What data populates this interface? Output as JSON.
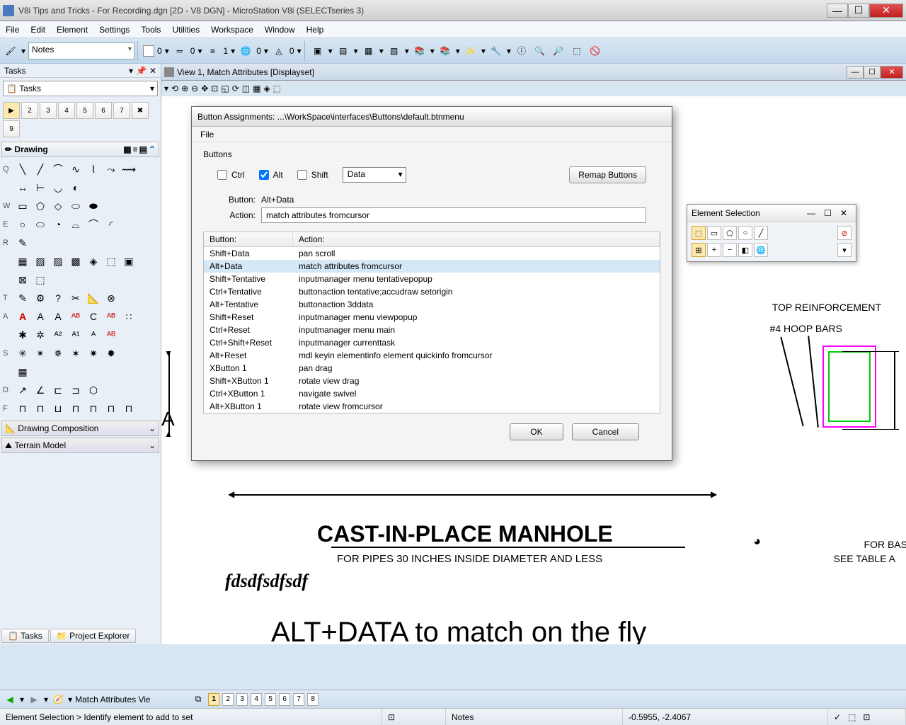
{
  "window": {
    "title": "V8i Tips and Tricks - For Recording.dgn [2D - V8 DGN] - MicroStation V8i (SELECTseries 3)"
  },
  "menubar": [
    "File",
    "Edit",
    "Element",
    "Settings",
    "Tools",
    "Utilities",
    "Workspace",
    "Window",
    "Help"
  ],
  "toolbar": {
    "level_combo": "Notes",
    "val0a": "0",
    "val0b": "0",
    "val1": "1",
    "val0c": "0",
    "val0d": "0"
  },
  "tasks": {
    "header": "Tasks",
    "dropdown": "Tasks",
    "drawing_header": "Drawing",
    "rows": [
      "Q",
      "W",
      "E",
      "R",
      "T",
      "A",
      "S",
      "D",
      "F"
    ],
    "collapse1": "Drawing Composition",
    "collapse2": "Terrain Model",
    "tab1": "Tasks",
    "tab2": "Project Explorer"
  },
  "view": {
    "title": "View 1, Match Attributes [Displayset]"
  },
  "drawing": {
    "title": "CAST-IN-PLACE MANHOLE",
    "subtitle": "FOR PIPES 30 INCHES INSIDE DIAMETER AND LESS",
    "script": "fdsdfsdfsdf",
    "bigtext": "ALT+DATA to match on the fly",
    "note1": "TOP REINFORCEMENT",
    "note2": "#4 HOOP BARS",
    "note3a": "FOR BASE SLAB DIMEN",
    "note3b": "SEE TABLE A",
    "dimA": "A"
  },
  "elem_sel": {
    "title": "Element Selection"
  },
  "dialog": {
    "title": "Button Assignments: ...\\WorkSpace\\interfaces\\Buttons\\default.btnmenu",
    "menu_file": "File",
    "group": "Buttons",
    "chk_ctrl": "Ctrl",
    "chk_alt": "Alt",
    "chk_shift": "Shift",
    "combo": "Data",
    "remap": "Remap Buttons",
    "button_label": "Button:",
    "button_value": "Alt+Data",
    "action_label": "Action:",
    "action_value": "match attributes fromcursor",
    "hdr_button": "Button:",
    "hdr_action": "Action:",
    "rows": [
      {
        "b": "Shift+Data",
        "a": "pan scroll"
      },
      {
        "b": "Alt+Data",
        "a": "match attributes fromcursor"
      },
      {
        "b": "Shift+Tentative",
        "a": "inputmanager menu tentativepopup"
      },
      {
        "b": "Ctrl+Tentative",
        "a": "buttonaction tentative;accudraw setorigin"
      },
      {
        "b": "Alt+Tentative",
        "a": "buttonaction 3ddata"
      },
      {
        "b": "Shift+Reset",
        "a": "inputmanager menu viewpopup"
      },
      {
        "b": "Ctrl+Reset",
        "a": "inputmanager menu main"
      },
      {
        "b": "Ctrl+Shift+Reset",
        "a": "inputmanager currenttask"
      },
      {
        "b": "Alt+Reset",
        "a": "mdl keyin elementinfo element quickinfo fromcursor"
      },
      {
        "b": "XButton 1",
        "a": "pan drag"
      },
      {
        "b": "Shift+XButton 1",
        "a": "rotate view drag"
      },
      {
        "b": "Ctrl+XButton 1",
        "a": "navigate swivel"
      },
      {
        "b": "Alt+XButton 1",
        "a": "rotate view fromcursor"
      }
    ],
    "ok": "OK",
    "cancel": "Cancel"
  },
  "bottom": {
    "combo": "Match Attributes Vie",
    "views": [
      "1",
      "2",
      "3",
      "4",
      "5",
      "6",
      "7",
      "8"
    ]
  },
  "status": {
    "prompt": "Element Selection > Identify element to add to set",
    "level": "Notes",
    "coords": "-0.5955, -2.4067"
  }
}
